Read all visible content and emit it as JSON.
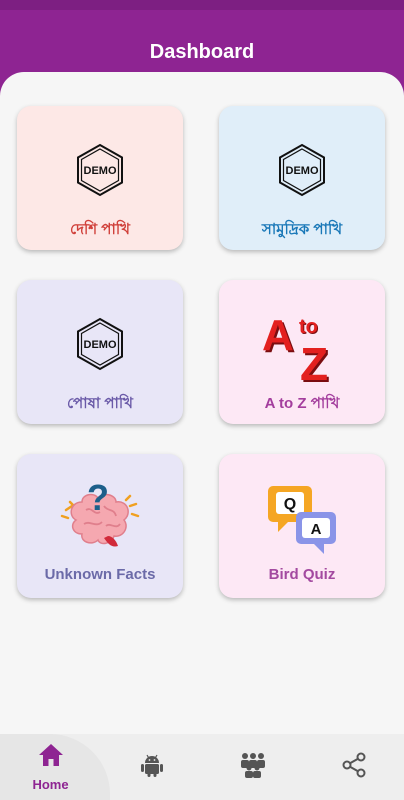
{
  "app": {
    "title": "Dashboard"
  },
  "colors": {
    "primary": "#8e2492",
    "content_bg": "#f6f6f6",
    "nav_bg": "#eeeeee",
    "icon_gray": "#555555"
  },
  "cards": [
    {
      "label": "দেশি পাখি",
      "icon": "demo-badge-icon",
      "bg": "#fde8e6",
      "color": "#d0403a"
    },
    {
      "label": "সামুদ্রিক পাখি",
      "icon": "demo-badge-icon",
      "bg": "#e0eef9",
      "color": "#1a78b8"
    },
    {
      "label": "পোষা পাখি",
      "icon": "demo-badge-icon",
      "bg": "#e8e6f7",
      "color": "#6a5aa8"
    },
    {
      "label": "A to Z পাখি",
      "icon": "a-to-z-icon",
      "bg": "#fde8f5",
      "color": "#a33d9d",
      "icon_letters": {
        "a": "A",
        "to": "to",
        "z": "Z"
      }
    },
    {
      "label": "Unknown Facts",
      "icon": "brain-question-icon",
      "bg": "#e8e6f7",
      "color": "#6b6aa8",
      "icon_mark": "?"
    },
    {
      "label": "Bird Quiz",
      "icon": "quiz-bubbles-icon",
      "bg": "#fde8f5",
      "color": "#a34aa0",
      "icon_letters": {
        "q": "Q",
        "a": "A"
      }
    }
  ],
  "demo_badge": {
    "text": "DEMO"
  },
  "bottom_nav": [
    {
      "label": "Home",
      "icon": "home-icon",
      "active": true
    },
    {
      "label": "",
      "icon": "android-icon",
      "active": false
    },
    {
      "label": "",
      "icon": "community-icon",
      "active": false
    },
    {
      "label": "",
      "icon": "share-icon",
      "active": false
    }
  ]
}
